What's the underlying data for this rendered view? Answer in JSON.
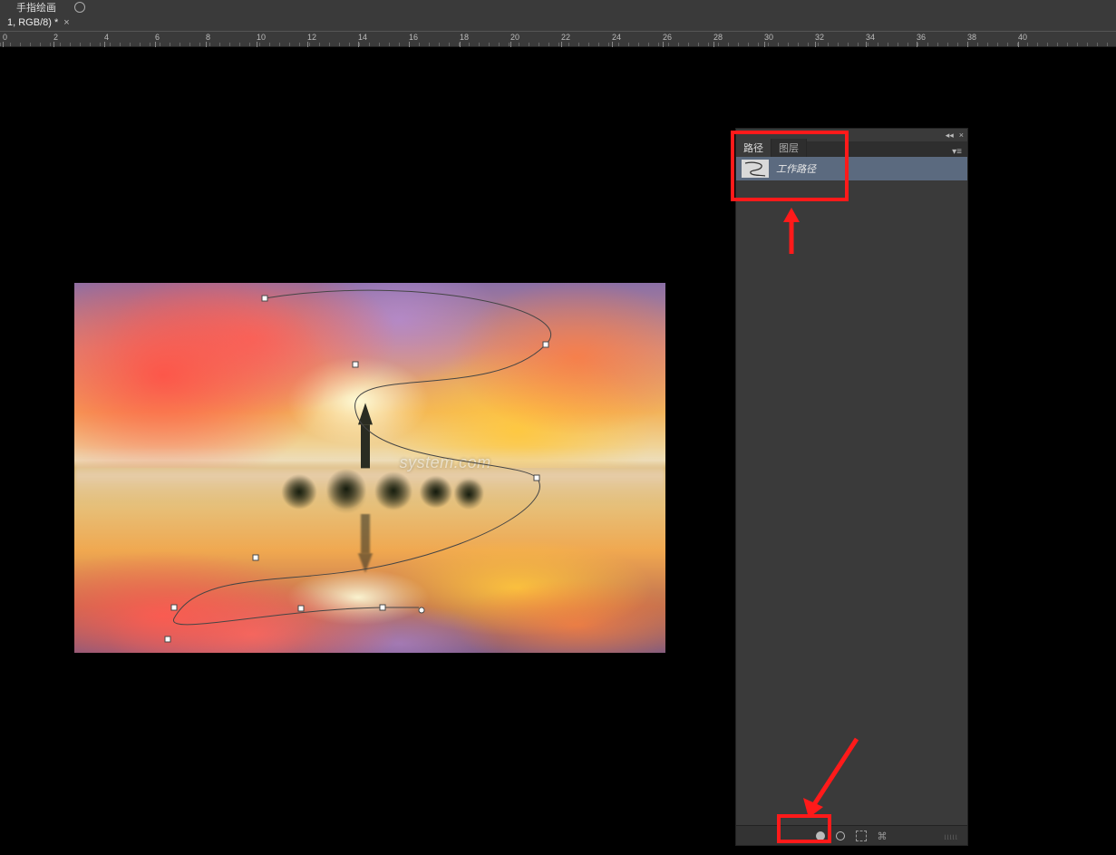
{
  "menu": {
    "option_label": "手指绘画"
  },
  "document_tab": {
    "label": "1, RGB/8) *",
    "close": "×"
  },
  "ruler": {
    "labels": [
      "0",
      "2",
      "4",
      "6",
      "8",
      "0",
      "2",
      "4",
      "6",
      "8",
      "0",
      "2",
      "4",
      "6",
      "8",
      "0",
      "2",
      "4",
      "6",
      "8",
      "0"
    ],
    "numbers": [
      0,
      2,
      4,
      6,
      8,
      10,
      12,
      14,
      16,
      18,
      20,
      22,
      24,
      26,
      28,
      30,
      32,
      34,
      36,
      38,
      40
    ]
  },
  "watermark_text": "system.com",
  "panel": {
    "collapse_glyph": "◂◂",
    "close_glyph": "×",
    "menu_glyph": "▾≡",
    "tabs": {
      "paths": "路径",
      "layers": "图层"
    },
    "path_item_label": "工作路径",
    "footer_icons": [
      "fill-path",
      "stroke-path",
      "path-to-selection",
      "link"
    ]
  }
}
